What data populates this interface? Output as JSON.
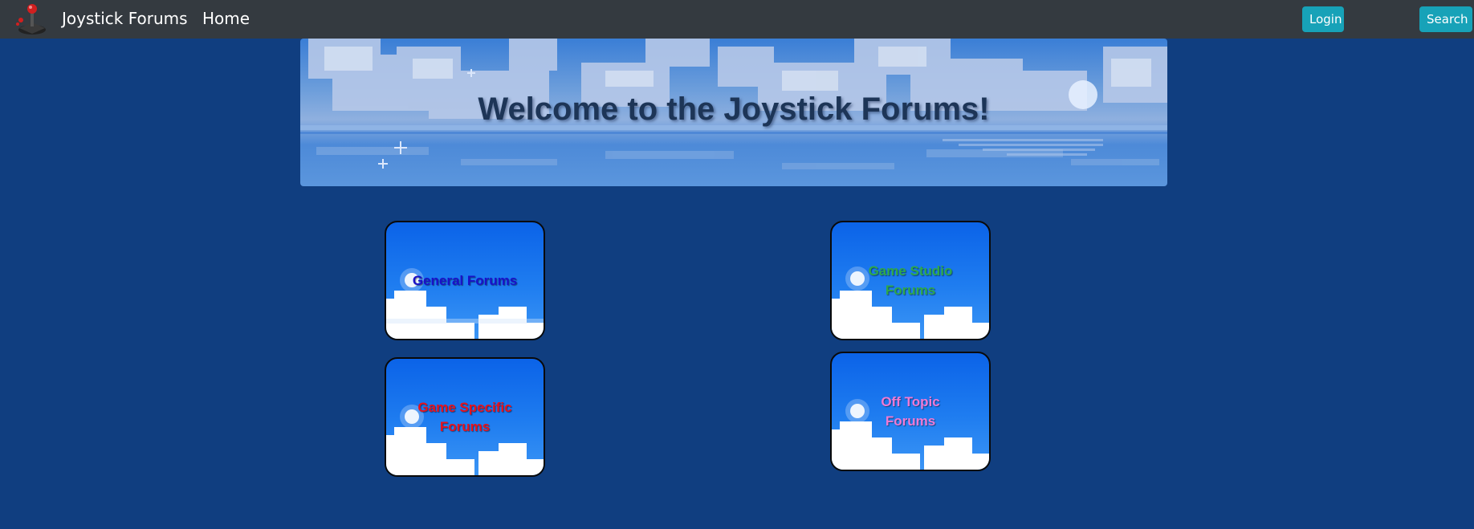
{
  "navbar": {
    "brand": "Joystick Forums",
    "home": "Home",
    "login": "Login",
    "search": "Search",
    "logo_icon": "joystick-icon"
  },
  "banner": {
    "title": "Welcome to the Joystick Forums!"
  },
  "cards": [
    {
      "label": "General Forums",
      "color": "#1a10c9"
    },
    {
      "label": "Game Studio Forums",
      "color": "#2fa84a"
    },
    {
      "label": "Game Specific Forums",
      "color": "#e8121c"
    },
    {
      "label": "Off Topic Forums",
      "color": "#f07ad4"
    }
  ],
  "colors": {
    "page_background": "#103e80",
    "navbar_background": "#343a40",
    "button_accent": "#17a2b8"
  }
}
